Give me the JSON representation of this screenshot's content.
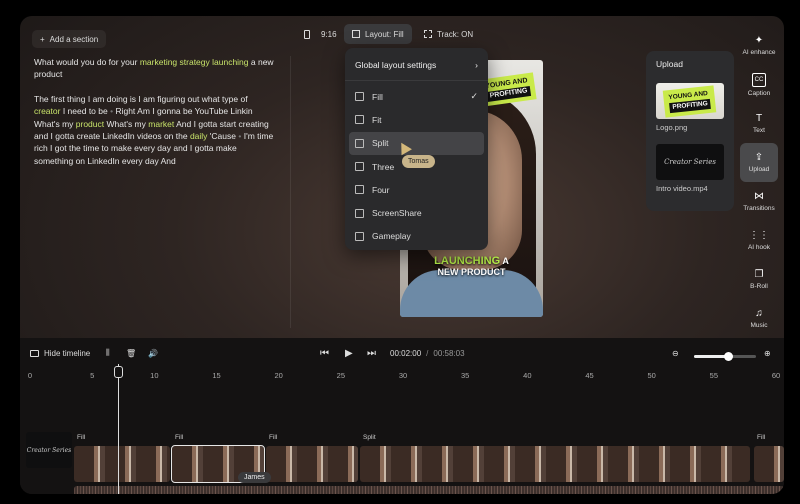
{
  "topbar": {
    "add_section": "Add a section",
    "aspect": "9:16",
    "layout": "Layout: Fill",
    "track": "Track: ON"
  },
  "transcript": {
    "p1": [
      {
        "t": "What would you do for your ",
        "hl": false
      },
      {
        "t": "marketing strategy launching",
        "hl": true
      },
      {
        "t": " a new product",
        "hl": false
      }
    ],
    "p2": [
      {
        "t": "The first thing I am doing is I am figuring out what type of ",
        "hl": false
      },
      {
        "t": "creator",
        "hl": true
      },
      {
        "t": " I need to be ",
        "hl": false
      },
      {
        "t": "•",
        "dot": true
      },
      {
        "t": " Right Am I gonna be YouTube Linkin What's my ",
        "hl": false
      },
      {
        "t": "product",
        "hl": true
      },
      {
        "t": " What's my ",
        "hl": false
      },
      {
        "t": "market",
        "hl": true
      },
      {
        "t": " And I gotta start creating and I gotta create LinkedIn videos on the ",
        "hl": false
      },
      {
        "t": "daily",
        "hl": true
      },
      {
        "t": " 'Cause ",
        "hl": false
      },
      {
        "t": "•",
        "dot": true
      },
      {
        "t": " I'm time rich I got the time to make every day and I gotta make something on LinkedIn every day And",
        "hl": false
      }
    ]
  },
  "preview": {
    "sticker_line1": "YOUNG AND",
    "sticker_line2": "PROFITING",
    "caption_green": "LAUNCHING",
    "caption_white1": " A",
    "caption_white2": "NEW PRODUCT"
  },
  "layout_menu": {
    "title": "Global layout settings",
    "items": [
      "Fill",
      "Fit",
      "Split",
      "Three",
      "Four",
      "ScreenShare",
      "Gameplay"
    ],
    "selected": "Fill",
    "hovered": "Split",
    "cursor_label": "Tomas"
  },
  "upload_panel": {
    "title": "Upload",
    "assets": [
      {
        "name": "Logo.png",
        "line1": "YOUNG AND",
        "line2": "PROFITING"
      },
      {
        "name": "Intro video.mp4",
        "line1": "Creator Series"
      }
    ]
  },
  "toolbar": {
    "items": [
      {
        "label": "AI enhance",
        "icon": "sparkle-icon",
        "glyph": "✦"
      },
      {
        "label": "Caption",
        "icon": "cc-icon",
        "glyph": "CC"
      },
      {
        "label": "Text",
        "icon": "text-icon",
        "glyph": "T"
      },
      {
        "label": "Upload",
        "icon": "upload-icon",
        "glyph": "⇪",
        "active": true
      },
      {
        "label": "Transitions",
        "icon": "transitions-icon",
        "glyph": "⋈"
      },
      {
        "label": "AI hook",
        "icon": "waveform-icon",
        "glyph": "⋮⋮"
      },
      {
        "label": "B-Roll",
        "icon": "broll-icon",
        "glyph": "❐"
      },
      {
        "label": "Music",
        "icon": "music-icon",
        "glyph": "♫"
      }
    ]
  },
  "timeline": {
    "hide_label": "Hide timeline",
    "current_time": "00:02:00",
    "separator": "/",
    "total_time": "00:58:03",
    "zoom_level": 0.55,
    "ticks": [
      "0",
      "5",
      "10",
      "15",
      "20",
      "25",
      "30",
      "35",
      "40",
      "45",
      "50",
      "55",
      "60"
    ],
    "clips": [
      {
        "label": "Fill"
      },
      {
        "label": "Fill"
      },
      {
        "label": "Fill"
      },
      {
        "label": "Split"
      },
      {
        "label": "Fill"
      }
    ],
    "intro_thumb": "Creator Series",
    "cursor_label": "James"
  },
  "colors": {
    "accent_green": "#c8e36a",
    "sticker": "#c9ea4a",
    "background": "#2e2522"
  }
}
